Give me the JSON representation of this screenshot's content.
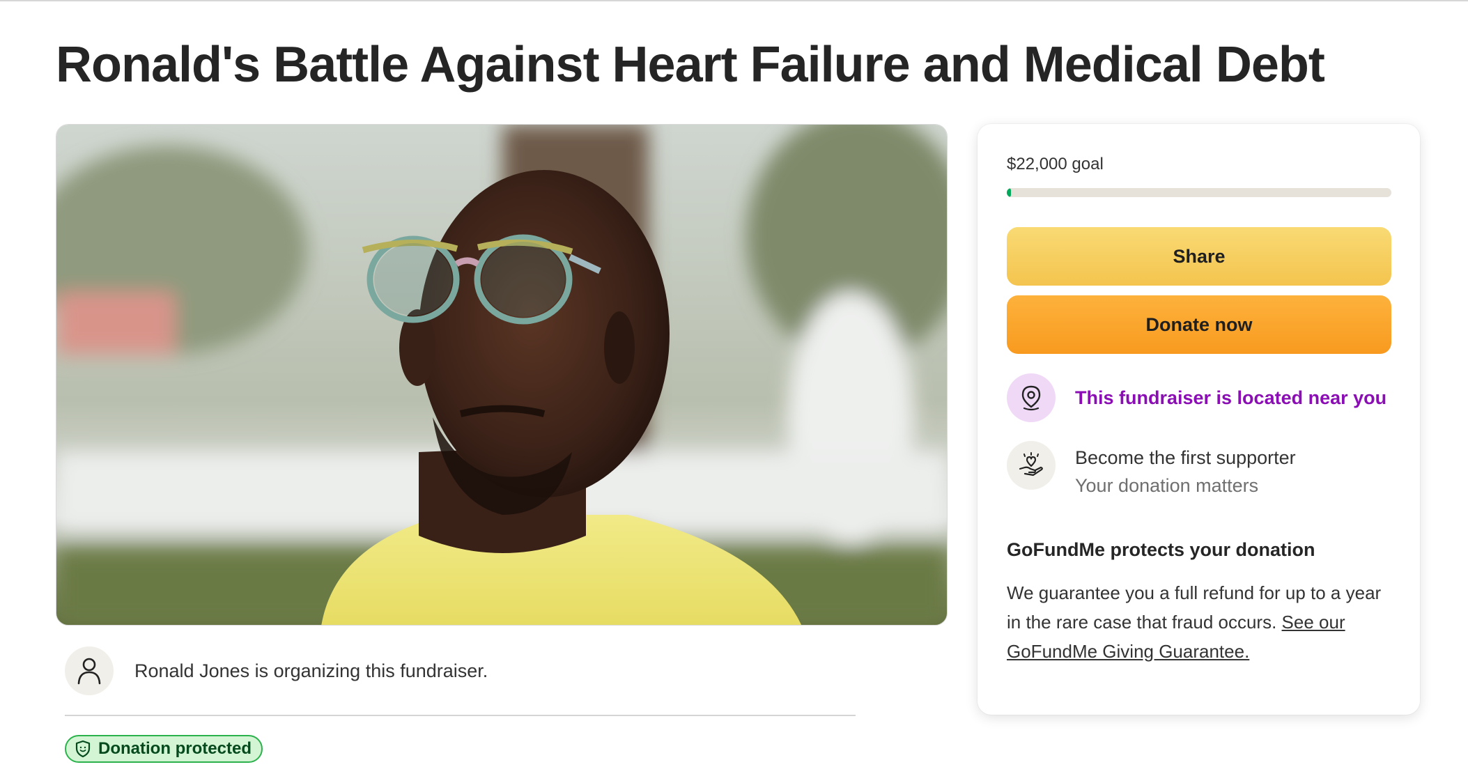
{
  "page": {
    "title": "Ronald's Battle Against Heart Failure and Medical Debt"
  },
  "hero": {
    "icon": "fundraiser-photo-portrait"
  },
  "organizer": {
    "text": "Ronald Jones is organizing this fundraiser.",
    "icon": "person-icon"
  },
  "badge": {
    "label": "Donation protected",
    "icon": "shield-icon"
  },
  "card": {
    "goal_text": "$22,000 goal",
    "progress_fraction": 0.01,
    "share_label": "Share",
    "donate_label": "Donate now",
    "near_text": "This fundraiser is located near you",
    "near_icon": "location-pin-icon",
    "supporter_title": "Become the first supporter",
    "supporter_subtitle": "Your donation matters",
    "supporter_icon": "heart-hand-icon",
    "protects_heading": "GoFundMe protects your donation",
    "protects_body": "We guarantee you a full refund for up to a year in the rare case that fraud occurs. ",
    "protects_link": "See our GoFundMe Giving Guarantee."
  },
  "colors": {
    "accent_green": "#02a95c",
    "share_yellow": "#f6cf5e",
    "donate_orange": "#fba72e",
    "near_purple": "#8a0eb4"
  }
}
